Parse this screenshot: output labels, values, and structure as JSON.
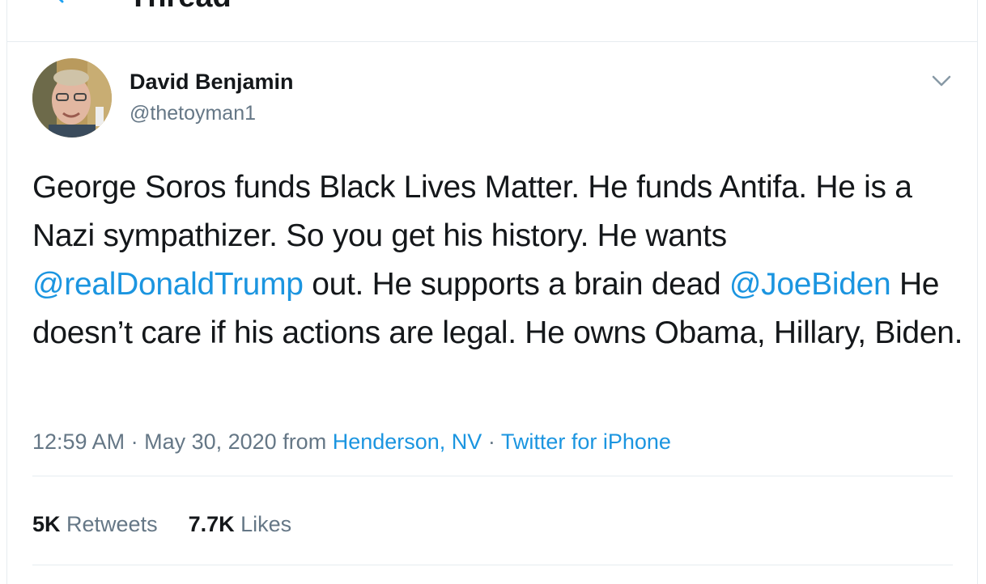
{
  "header": {
    "title": "Thread"
  },
  "tweet": {
    "display_name": "David Benjamin",
    "handle": "@thetoyman1",
    "text": {
      "p1": "George Soros funds Black Lives Matter. He funds Antifa. He is a Nazi sympathizer. So you get his history. He wants ",
      "mention1": "@realDonaldTrump",
      "p2": " out. He supports a brain dead ",
      "mention2": "@JoeBiden",
      "p3": " He doesn’t care if his actions are legal. He owns Obama, Hillary, Biden."
    },
    "meta": {
      "time": "12:59 AM",
      "sep1": " · ",
      "date": "May 30, 2020",
      "from": " from ",
      "location": "Henderson, NV",
      "sep2": " · ",
      "source": "Twitter for iPhone"
    },
    "stats": {
      "retweets_count": "5K",
      "retweets_label": "Retweets",
      "likes_count": "7.7K",
      "likes_label": "Likes"
    }
  },
  "colors": {
    "link": "#1b95e0",
    "secondary_text": "#657786",
    "primary_text": "#14171a",
    "divider": "#e6ecf0"
  },
  "icons": {
    "back": "arrow-left-icon",
    "caret": "chevron-down-icon"
  }
}
